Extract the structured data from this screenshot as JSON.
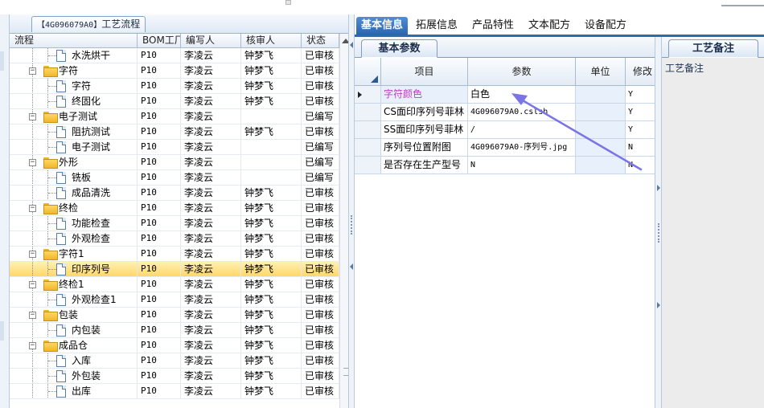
{
  "left_panel": {
    "title_code": "【4G096079A0】",
    "title_text": "工艺流程",
    "columns": [
      "流程",
      "BOM工厂",
      "编写人",
      "核审人",
      "状态"
    ]
  },
  "tree": [
    {
      "label": "水洗烘干",
      "kind": "leaf",
      "level": 2,
      "plant": "P10",
      "author": "李凌云",
      "reviewer": "钟梦飞",
      "status": "已审核"
    },
    {
      "label": "字符",
      "kind": "group",
      "level": 1,
      "plant": "P10",
      "author": "李凌云",
      "reviewer": "钟梦飞",
      "status": "已审核"
    },
    {
      "label": "字符",
      "kind": "leaf",
      "level": 2,
      "plant": "P10",
      "author": "李凌云",
      "reviewer": "钟梦飞",
      "status": "已审核"
    },
    {
      "label": "终固化",
      "kind": "leaf",
      "level": 2,
      "plant": "P10",
      "author": "李凌云",
      "reviewer": "钟梦飞",
      "status": "已审核"
    },
    {
      "label": "电子测试",
      "kind": "group",
      "level": 1,
      "plant": "P10",
      "author": "李凌云",
      "reviewer": "",
      "status": "已编写"
    },
    {
      "label": "阻抗测试",
      "kind": "leaf",
      "level": 2,
      "plant": "P10",
      "author": "李凌云",
      "reviewer": "钟梦飞",
      "status": "已审核"
    },
    {
      "label": "电子测试",
      "kind": "leaf",
      "level": 2,
      "plant": "P10",
      "author": "李凌云",
      "reviewer": "",
      "status": "已编写"
    },
    {
      "label": "外形",
      "kind": "group",
      "level": 1,
      "plant": "P10",
      "author": "李凌云",
      "reviewer": "",
      "status": "已编写"
    },
    {
      "label": "铣板",
      "kind": "leaf",
      "level": 2,
      "plant": "P10",
      "author": "李凌云",
      "reviewer": "",
      "status": "已编写"
    },
    {
      "label": "成品清洗",
      "kind": "leaf",
      "level": 2,
      "plant": "P10",
      "author": "李凌云",
      "reviewer": "钟梦飞",
      "status": "已审核"
    },
    {
      "label": "终检",
      "kind": "group",
      "level": 1,
      "plant": "P10",
      "author": "李凌云",
      "reviewer": "钟梦飞",
      "status": "已审核"
    },
    {
      "label": "功能检查",
      "kind": "leaf",
      "level": 2,
      "plant": "P10",
      "author": "李凌云",
      "reviewer": "钟梦飞",
      "status": "已审核"
    },
    {
      "label": "外观检查",
      "kind": "leaf",
      "level": 2,
      "plant": "P10",
      "author": "李凌云",
      "reviewer": "钟梦飞",
      "status": "已审核"
    },
    {
      "label": "字符1",
      "kind": "group",
      "level": 1,
      "plant": "P10",
      "author": "李凌云",
      "reviewer": "钟梦飞",
      "status": "已审核"
    },
    {
      "label": "印序列号",
      "kind": "leaf",
      "level": 2,
      "selected": true,
      "plant": "P10",
      "author": "李凌云",
      "reviewer": "钟梦飞",
      "status": "已审核"
    },
    {
      "label": "终检1",
      "kind": "group",
      "level": 1,
      "plant": "P10",
      "author": "李凌云",
      "reviewer": "钟梦飞",
      "status": "已审核"
    },
    {
      "label": "外观检查1",
      "kind": "leaf",
      "level": 2,
      "plant": "P10",
      "author": "李凌云",
      "reviewer": "钟梦飞",
      "status": "已审核"
    },
    {
      "label": "包装",
      "kind": "group",
      "level": 1,
      "plant": "P10",
      "author": "李凌云",
      "reviewer": "钟梦飞",
      "status": "已审核"
    },
    {
      "label": "内包装",
      "kind": "leaf",
      "level": 2,
      "plant": "P10",
      "author": "李凌云",
      "reviewer": "钟梦飞",
      "status": "已审核"
    },
    {
      "label": "成品仓",
      "kind": "group",
      "level": 1,
      "plant": "P10",
      "author": "李凌云",
      "reviewer": "钟梦飞",
      "status": "已审核"
    },
    {
      "label": "入库",
      "kind": "leaf",
      "level": 2,
      "plant": "P10",
      "author": "李凌云",
      "reviewer": "钟梦飞",
      "status": "已审核"
    },
    {
      "label": "外包装",
      "kind": "leaf",
      "level": 2,
      "plant": "P10",
      "author": "李凌云",
      "reviewer": "钟梦飞",
      "status": "已审核"
    },
    {
      "label": "出库",
      "kind": "leaf",
      "level": 2,
      "plant": "P10",
      "author": "李凌云",
      "reviewer": "钟梦飞",
      "status": "已审核"
    }
  ],
  "top_tabs": [
    {
      "label": "基本信息",
      "active": true
    },
    {
      "label": "拓展信息"
    },
    {
      "label": "产品特性"
    },
    {
      "label": "文本配方"
    },
    {
      "label": "设备配方"
    }
  ],
  "params": {
    "subtab": "基本参数",
    "columns": [
      "项目",
      "参数",
      "单位",
      "修改"
    ],
    "rows": [
      {
        "item": "字符颜色",
        "value": "白色",
        "unit": "",
        "modify": "Y"
      },
      {
        "item": "CS面印序列号菲林",
        "value": "4G096079A0.cslsh",
        "unit": "",
        "modify": "Y"
      },
      {
        "item": "SS面印序列号菲林",
        "value": "/",
        "unit": "",
        "modify": "Y"
      },
      {
        "item": "序列号位置附图",
        "value": "4G096079A0-序列号.jpg",
        "unit": "",
        "modify": "N"
      },
      {
        "item": "是否存在生产型号",
        "value": "N",
        "unit": "",
        "modify": "N"
      }
    ]
  },
  "notes": {
    "subtab": "工艺备注",
    "label": "工艺备注"
  },
  "colors": {
    "accent": "#2c6bb3",
    "selected_row": "#ffd86a",
    "annotation_arrow": "#7b74e6",
    "highlight_text": "#c03cc0"
  },
  "icons": {
    "group": "folder-icon",
    "leaf": "document-icon",
    "expander": "collapse-icon"
  }
}
